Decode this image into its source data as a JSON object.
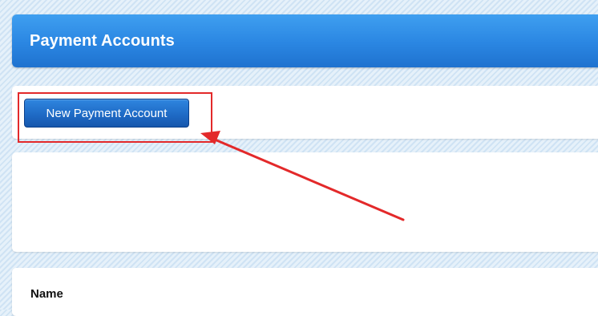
{
  "page": {
    "title": "Payment Accounts"
  },
  "actions": {
    "new_button_label": "New Payment Account"
  },
  "table": {
    "columns": [
      "Name"
    ]
  },
  "annotation": {
    "color": "#e3292a"
  },
  "colors": {
    "header_blue": "#2a86e2",
    "button_blue": "#1f6bc6"
  }
}
